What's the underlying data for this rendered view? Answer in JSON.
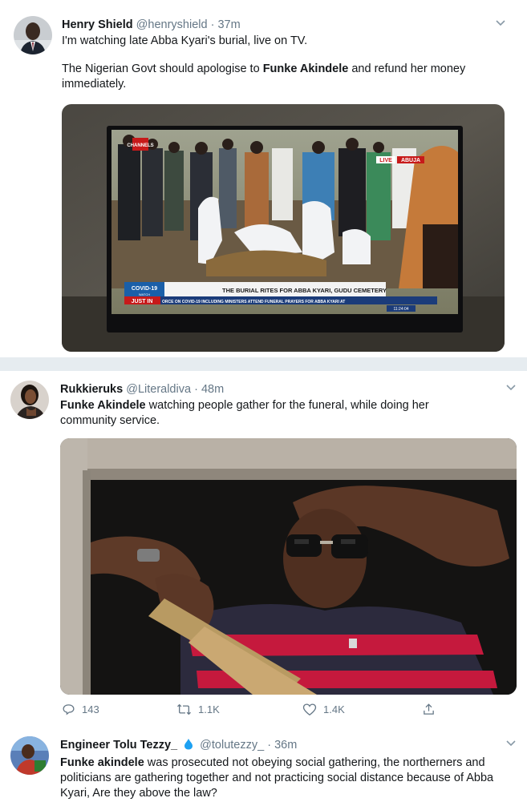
{
  "tweets": [
    {
      "name": "Henry Shield",
      "handle": "@henryshield",
      "separator": "·",
      "time": "37m",
      "line1": "I'm watching late Abba Kyari's burial, live on TV.",
      "line2_pre": "The Nigerian Govt should apologise to ",
      "line2_bold": "Funke Akindele",
      "line2_post": " and refund her money immediately.",
      "media": {
        "channel_logo": "CHANNELS",
        "live_badge": "LIVE",
        "location": "ABUJA",
        "covid_tag": "COVID-19",
        "covid_sub": "WATCH",
        "lower_third": "THE BURIAL RITES FOR ABBA KYARI, GUDU CEMETERY",
        "just_in": "JUST IN",
        "ticker": "ORCE ON COVID-19 INCLUDING MINISTERS ATTEND FUNERAL PRAYERS FOR ABBA KYARI AT",
        "clock": "11:24:04"
      }
    },
    {
      "name": "Rukkieruks",
      "handle": "@Literaldiva",
      "separator": "·",
      "time": "48m",
      "text_bold": "Funke Akindele",
      "text_post": " watching people gather for the funeral, while doing her community service.",
      "counts": {
        "replies": "143",
        "retweets": "1.1K",
        "likes": "1.4K"
      }
    },
    {
      "name": "Engineer Tolu Tezzy_",
      "handle": "@tolutezzy_",
      "separator": "·",
      "time": "36m",
      "text_bold": "Funke akindele",
      "text_post": " was prosecuted not obeying social gathering, the northerners and politicians are gathering together and not practicing social distance because of Abba Kyari, Are they above the law?"
    }
  ],
  "colors": {
    "background": "#e6ecf0",
    "card": "#ffffff",
    "text": "#14171a",
    "secondary": "#657786",
    "verified_blue": "#1da1f2"
  },
  "icons": [
    "chevron-down-icon",
    "reply-icon",
    "retweet-icon",
    "like-icon",
    "share-icon",
    "verified-icon"
  ]
}
